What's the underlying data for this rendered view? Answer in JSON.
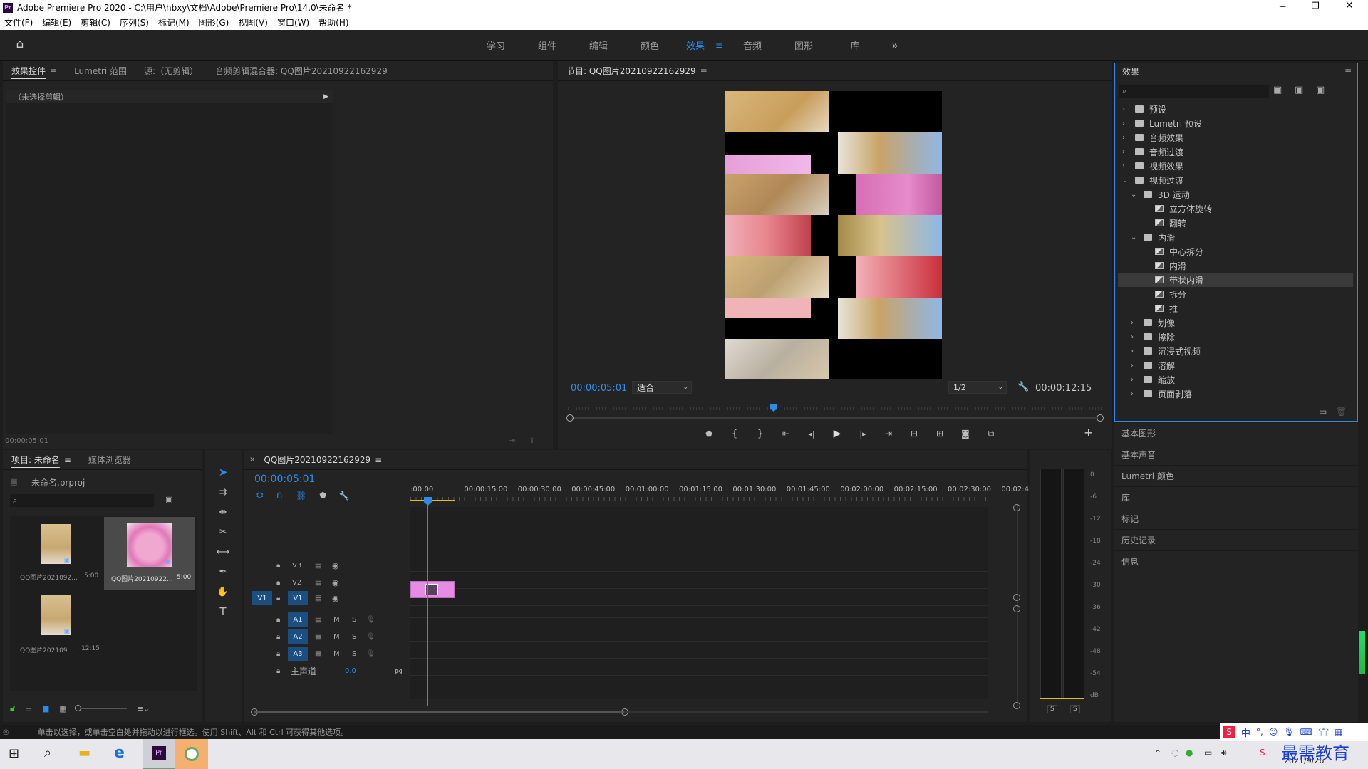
{
  "window": {
    "title": "Adobe Premiere Pro 2020 - C:\\用户\\hbxy\\文档\\Adobe\\Premiere Pro\\14.0\\未命名 *"
  },
  "menu": [
    "文件(F)",
    "编辑(E)",
    "剪辑(C)",
    "序列(S)",
    "标记(M)",
    "图形(G)",
    "视图(V)",
    "窗口(W)",
    "帮助(H)"
  ],
  "workspaces": [
    "学习",
    "组件",
    "编辑",
    "颜色",
    "效果",
    "音频",
    "图形",
    "库"
  ],
  "workspace_active": "效果",
  "source_panel": {
    "tabs": [
      "效果控件",
      "Lumetri 范围",
      "源:（无剪辑）",
      "音频剪辑混合器: QQ图片20210922162929"
    ],
    "no_clip": "（未选择剪辑）",
    "timecode": "00:00:05:01"
  },
  "program": {
    "title": "节目: QQ图片20210922162929",
    "timecode": "00:00:05:01",
    "fit": "适合",
    "quality": "1/2",
    "duration": "00:00:12:15",
    "playhead_fraction": 0.385
  },
  "project": {
    "tabs": [
      "项目: 未命名",
      "媒体浏览器"
    ],
    "file": "未命名.prproj",
    "items": [
      {
        "name": "QQ图片2021092...",
        "dur": "5:00"
      },
      {
        "name": "QQ图片20210922...",
        "dur": "5:00"
      },
      {
        "name": "QQ图片202109...",
        "dur": "12:15"
      }
    ]
  },
  "timeline": {
    "tab": "QQ图片20210922162929",
    "timecode": "00:00:05:01",
    "ruler": [
      ":00:00",
      "00:00:15:00",
      "00:00:30:00",
      "00:00:45:00",
      "00:01:00:00",
      "00:01:15:00",
      "00:01:30:00",
      "00:01:45:00",
      "00:02:00:00",
      "00:02:15:00",
      "00:02:30:00",
      "00:02:45:"
    ],
    "video_tracks": [
      "V3",
      "V2",
      "V1"
    ],
    "audio_tracks": [
      "A1",
      "A2",
      "A3"
    ],
    "src_patch": "V1",
    "master": "主声道",
    "master_val": "0.0",
    "m": "M",
    "s": "S"
  },
  "meter": {
    "scale": [
      "0",
      "-6",
      "-12",
      "-18",
      "-24",
      "-30",
      "-36",
      "-42",
      "-48",
      "-54",
      "dB"
    ],
    "solo": [
      "S",
      "S"
    ]
  },
  "effects": {
    "title": "效果",
    "tree": [
      {
        "label": "预设",
        "level": 0,
        "type": "preset",
        "open": false
      },
      {
        "label": "Lumetri 预设",
        "level": 0,
        "type": "preset",
        "open": false
      },
      {
        "label": "音频效果",
        "level": 0,
        "type": "folder",
        "open": false
      },
      {
        "label": "音频过渡",
        "level": 0,
        "type": "folder",
        "open": false
      },
      {
        "label": "视频效果",
        "level": 0,
        "type": "folder",
        "open": false
      },
      {
        "label": "视频过渡",
        "level": 0,
        "type": "folder",
        "open": true
      },
      {
        "label": "3D 运动",
        "level": 1,
        "type": "folder",
        "open": true
      },
      {
        "label": "立方体旋转",
        "level": 2,
        "type": "fx"
      },
      {
        "label": "翻转",
        "level": 2,
        "type": "fx"
      },
      {
        "label": "内滑",
        "level": 1,
        "type": "folder",
        "open": true
      },
      {
        "label": "中心拆分",
        "level": 2,
        "type": "fx"
      },
      {
        "label": "内滑",
        "level": 2,
        "type": "fx"
      },
      {
        "label": "带状内滑",
        "level": 2,
        "type": "fx",
        "selected": true
      },
      {
        "label": "拆分",
        "level": 2,
        "type": "fx"
      },
      {
        "label": "推",
        "level": 2,
        "type": "fx"
      },
      {
        "label": "划像",
        "level": 1,
        "type": "folder",
        "open": false
      },
      {
        "label": "擦除",
        "level": 1,
        "type": "folder",
        "open": false
      },
      {
        "label": "沉浸式视频",
        "level": 1,
        "type": "folder",
        "open": false
      },
      {
        "label": "溶解",
        "level": 1,
        "type": "folder",
        "open": false
      },
      {
        "label": "缩放",
        "level": 1,
        "type": "folder",
        "open": false
      },
      {
        "label": "页面剥落",
        "level": 1,
        "type": "folder",
        "open": false
      }
    ],
    "side_panels": [
      "基本图形",
      "基本声音",
      "Lumetri 颜色",
      "库",
      "标记",
      "历史记录",
      "信息"
    ]
  },
  "status": "单击以选择，或单击空白处并拖动以进行框选。使用 Shift、Alt 和 Ctrl 可获得其他选项。",
  "taskbar": {
    "date": "2021/9/26",
    "watermark": "最需教育",
    "ime": "中"
  },
  "colors": {
    "accent": "#2d8ceb",
    "clip": "#e58de5",
    "selected": "#3a3a3a"
  }
}
